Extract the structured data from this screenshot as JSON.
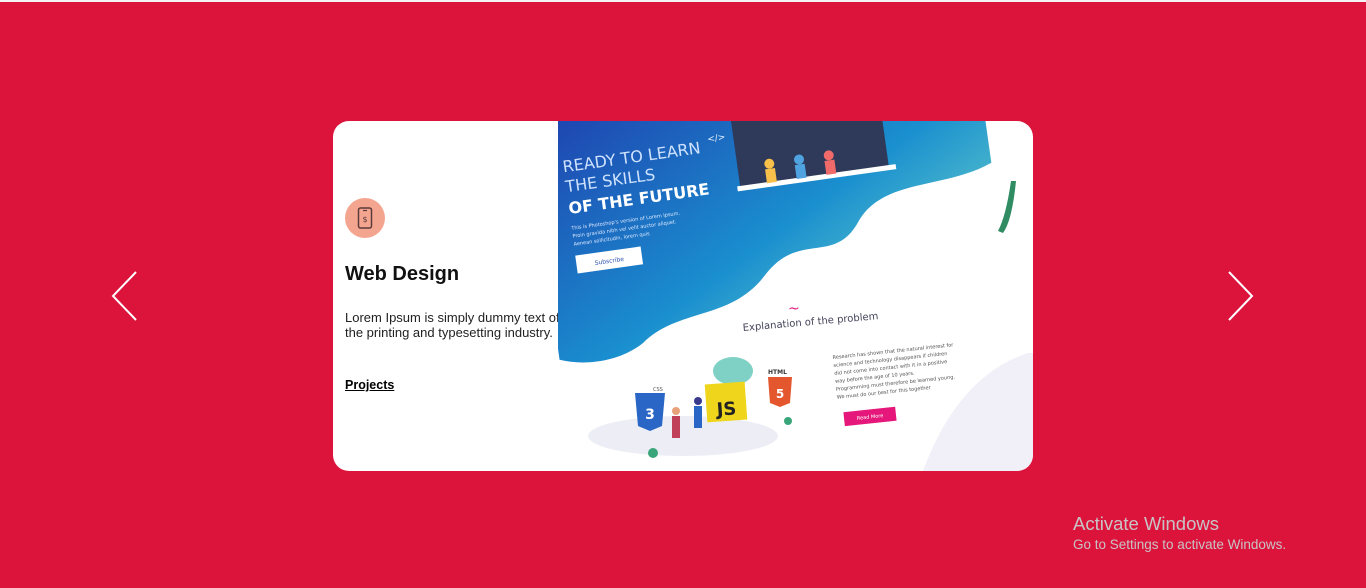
{
  "colors": {
    "background": "#dc143c",
    "card": "#ffffff",
    "icon_bg": "#f4a58f",
    "accent_pink": "#e6177a"
  },
  "navigation": {
    "prev_icon": "chevron-left-icon",
    "next_icon": "chevron-right-icon"
  },
  "card": {
    "icon": "smartphone-icon",
    "title": "Web Design",
    "description": "Lorem Ipsum is simply dummy text of the printing and typesetting industry.",
    "link_label": "Projects"
  },
  "preview": {
    "hero_line1": "READY TO LEARN",
    "hero_line2": "THE SKILLS",
    "hero_line3": "OF THE FUTURE",
    "hero_small1": "This is Photoshop's version of Lorem Ipsum.",
    "hero_small2": "Proin gravida nibh vel velit auctor aliquet.",
    "hero_small3": "Aenean sollicitudin, lorem quis",
    "subscribe": "Subscribe",
    "section_title": "Explanation of the problem",
    "para1": "Research has shown that the natural interest for",
    "para2": "science and technology disappears if children",
    "para3": "did not come into contact with it in a positive",
    "para4": "way before the age of 10 years.",
    "para5": "Programming must therefore be learned young.",
    "para6": "We must do our best for this together",
    "read_more": "Read More",
    "badge_css": "CSS",
    "badge_js": "JS",
    "badge_html": "HTML",
    "code_tag": "</>"
  },
  "watermark": {
    "title": "Activate Windows",
    "subtitle": "Go to Settings to activate Windows."
  }
}
